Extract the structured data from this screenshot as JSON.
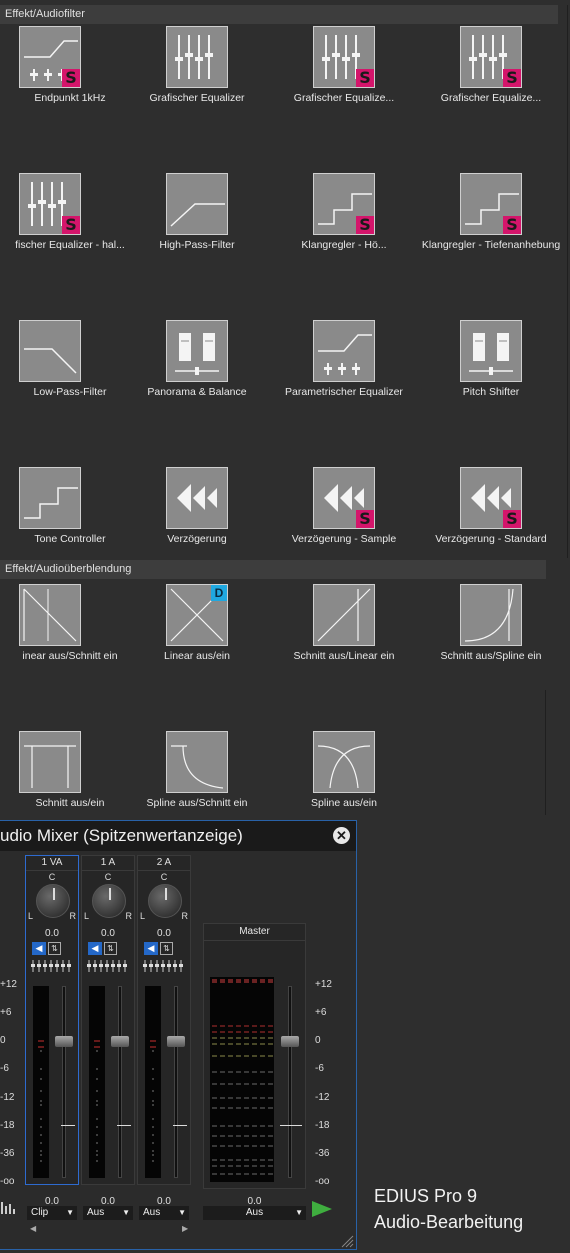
{
  "audiofilter": {
    "header": "Effekt/Audiofilter",
    "items": [
      {
        "label": "Endpunkt 1kHz",
        "icon": "parametric-eq-icon",
        "badge": "S"
      },
      {
        "label": "Grafischer Equalizer",
        "icon": "graphic-eq-icon",
        "badge": ""
      },
      {
        "label": "Grafischer Equalize...",
        "icon": "graphic-eq-icon",
        "badge": "S"
      },
      {
        "label": "Grafischer Equalize...",
        "icon": "graphic-eq-icon",
        "badge": "S"
      },
      {
        "label": "fischer Equalizer - hal...",
        "icon": "graphic-eq-icon",
        "badge": "S"
      },
      {
        "label": "High-Pass-Filter",
        "icon": "high-pass-icon",
        "badge": ""
      },
      {
        "label": "Klangregler - Hö...",
        "icon": "step-icon",
        "badge": "S"
      },
      {
        "label": "Klangregler - Tiefenanhebung",
        "icon": "step-icon",
        "badge": "S"
      },
      {
        "label": "Low-Pass-Filter",
        "icon": "low-pass-icon",
        "badge": ""
      },
      {
        "label": "Panorama & Balance",
        "icon": "panorama-icon",
        "badge": ""
      },
      {
        "label": "Parametrischer Equalizer",
        "icon": "parametric-eq-icon",
        "badge": ""
      },
      {
        "label": "Pitch Shifter",
        "icon": "panorama-icon",
        "badge": ""
      },
      {
        "label": "Tone Controller",
        "icon": "step-icon",
        "badge": ""
      },
      {
        "label": "Verzögerung",
        "icon": "delay-icon",
        "badge": ""
      },
      {
        "label": "Verzögerung - Sample",
        "icon": "delay-icon",
        "badge": "S"
      },
      {
        "label": "Verzögerung - Standard",
        "icon": "delay-icon",
        "badge": "S"
      }
    ]
  },
  "audiotransition": {
    "header": "Effekt/Audioüberblendung",
    "items": [
      {
        "label": "inear aus/Schnitt ein",
        "icon": "linear-cut-icon",
        "badge": ""
      },
      {
        "label": "Linear aus/ein",
        "icon": "linear-cross-icon",
        "badge": "D"
      },
      {
        "label": "Schnitt aus/Linear ein",
        "icon": "cut-linear-icon",
        "badge": ""
      },
      {
        "label": "Schnitt aus/Spline ein",
        "icon": "cut-spline-icon",
        "badge": ""
      },
      {
        "label": "Schnitt aus/ein",
        "icon": "cut-cut-icon",
        "badge": ""
      },
      {
        "label": "Spline aus/Schnitt ein",
        "icon": "spline-cut-icon",
        "badge": ""
      },
      {
        "label": "Spline aus/ein",
        "icon": "spline-cross-icon",
        "badge": ""
      }
    ]
  },
  "mixer": {
    "title": "udio Mixer (Spitzenwertanzeige)",
    "knob_center": "C",
    "knob_left": "L",
    "knob_right": "R",
    "channels": [
      {
        "name": "1 VA",
        "pan": "0.0",
        "level": "0.0",
        "mode": "Clip"
      },
      {
        "name": "1 A",
        "pan": "0.0",
        "level": "0.0",
        "mode": "Aus"
      },
      {
        "name": "2 A",
        "pan": "0.0",
        "level": "0.0",
        "mode": "Aus"
      }
    ],
    "master": {
      "name": "Master",
      "level": "0.0",
      "mode": "Aus"
    },
    "scale": [
      "+12",
      "+6",
      "0",
      "-6",
      "-12",
      "-18",
      "-36",
      "-oo"
    ]
  },
  "brand": {
    "line1": "EDIUS Pro 9",
    "line2": "Audio-Bearbeitung"
  },
  "colors": {
    "badge_s": "#d4156b",
    "badge_d": "#1fa8e0",
    "accent": "#2e6bd0",
    "play": "#3fae3f"
  }
}
